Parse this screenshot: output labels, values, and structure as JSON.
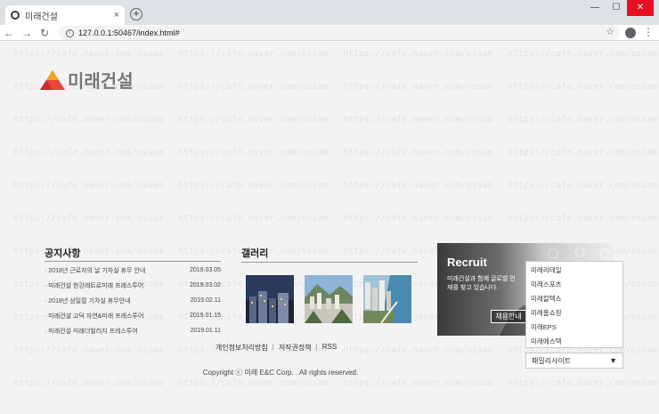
{
  "browser": {
    "tab_title": "미래건설",
    "tab_close": "×",
    "new_tab": "+",
    "url": "127.0.0.1:50467/index.html#",
    "window_controls": {
      "minimize": "—",
      "maximize": "☐",
      "close": "✕"
    },
    "nav": {
      "back": "←",
      "forward": "→",
      "reload": "↻"
    },
    "star": "☆",
    "menu": "⋮"
  },
  "page": {
    "logo_text": "미래건설",
    "watermark": "https://cafe.naver.com/ossam",
    "notice": {
      "title": "공지사항",
      "items": [
        {
          "text": "2018년 근로자의 날 기차실 휴무 안내",
          "date": "2019.03.05"
        },
        {
          "text": "미래건설 한강레트로미래 프레스투어",
          "date": "2019.03.02"
        },
        {
          "text": "2018년 삼일절 기차실 휴무안내",
          "date": "2019.02.11"
        },
        {
          "text": "미래건설 고덕 자연&미래 프레스투어",
          "date": "2019.01.15"
        },
        {
          "text": "미래건설 미래더빌리지 프레스투어",
          "date": "2019.01.11"
        }
      ]
    },
    "gallery": {
      "title": "갤러리"
    },
    "recruit": {
      "title": "Recruit",
      "text": "미래건설과 함께 글로벌 인재를 찾고 있습니다.",
      "button": "채용안내"
    },
    "family_site": {
      "options": [
        "미래리테일",
        "미래스포츠",
        "미래칼텍스",
        "미래홈쇼핑",
        "미래EPS",
        "미래에스텍"
      ],
      "selected": "패밀리사이트",
      "arrow": "▼"
    },
    "footer": {
      "links": [
        "개인정보처리방침",
        "저작권정책",
        "RSS"
      ],
      "copyright": "Copyright ⓒ 미래 E&C Corp. . All rights reserved."
    }
  }
}
